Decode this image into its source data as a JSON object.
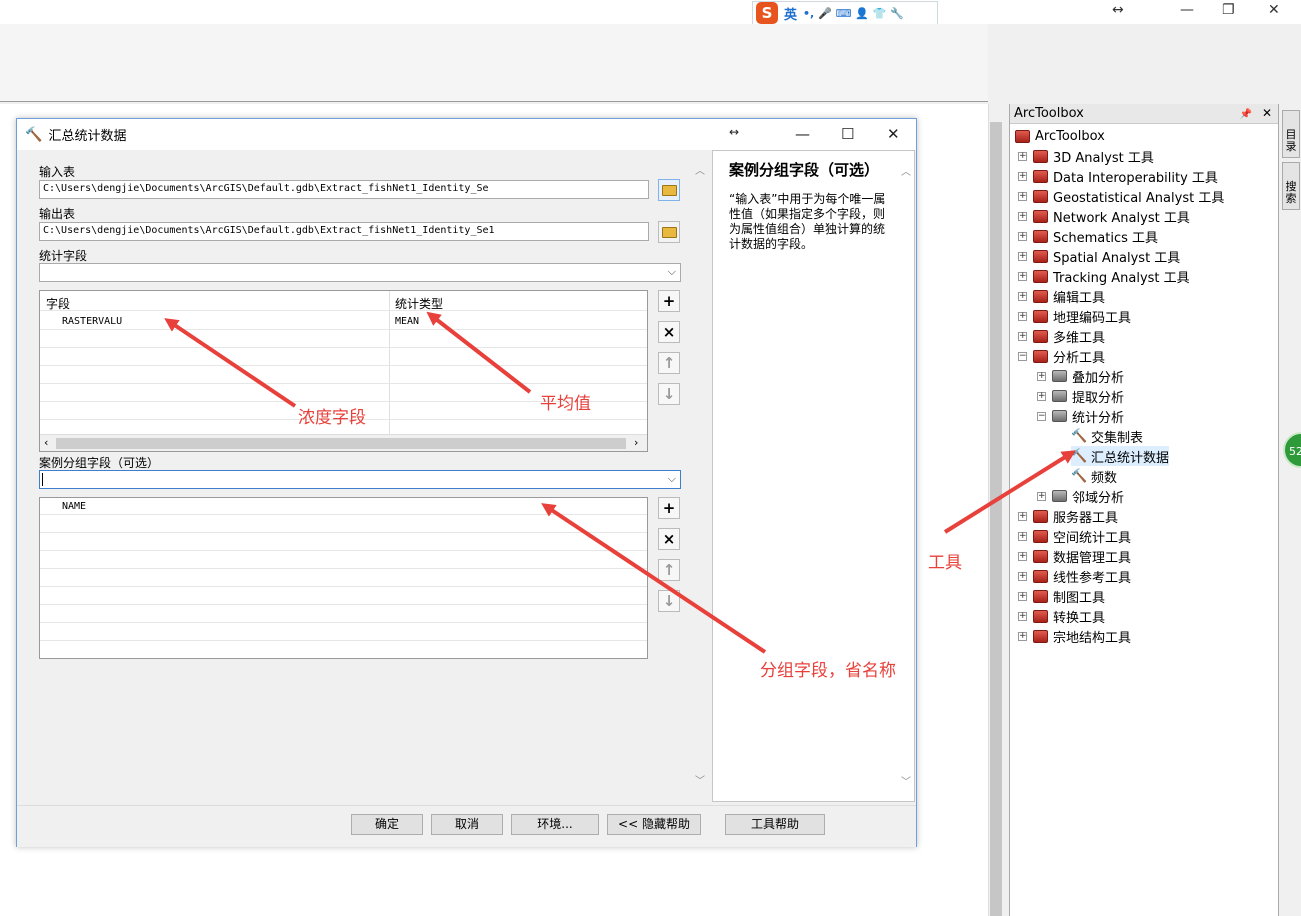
{
  "ime": {
    "logo": "S",
    "mode": "英",
    "glyphs": "•, 🎤 ⌨ 👤 👕 🔧"
  },
  "window_controls": {
    "resize": "↔",
    "minimize": "—",
    "restore": "❐",
    "close": "✕"
  },
  "dialog": {
    "title": "汇总统计数据",
    "input_table": {
      "label": "输入表",
      "value": "C:\\Users\\dengjie\\Documents\\ArcGIS\\Default.gdb\\Extract_fishNet1_Identity_Se"
    },
    "output_table": {
      "label": "输出表",
      "value": "C:\\Users\\dengjie\\Documents\\ArcGIS\\Default.gdb\\Extract_fishNet1_Identity_Se1"
    },
    "stat_fields": {
      "label": "统计字段",
      "columns": [
        "字段",
        "统计类型"
      ],
      "rows": [
        {
          "field": "RASTERVALU",
          "type": "MEAN"
        }
      ]
    },
    "case_field": {
      "label": "案例分组字段（可选）",
      "rows": [
        "NAME"
      ]
    },
    "buttons": {
      "ok": "确定",
      "cancel": "取消",
      "env": "环境...",
      "hide_help": "<< 隐藏帮助",
      "tool_help": "工具帮助"
    },
    "help": {
      "title": "案例分组字段（可选）",
      "text": "“输入表”中用于为每个唯一属性值（如果指定多个字段，则为属性值组合）单独计算的统计数据的字段。"
    }
  },
  "toolbox": {
    "title": "ArcToolbox",
    "pin": "📌",
    "close": "✕",
    "root": "ArcToolbox",
    "items": [
      "3D Analyst 工具",
      "Data Interoperability 工具",
      "Geostatistical Analyst 工具",
      "Network Analyst 工具",
      "Schematics 工具",
      "Spatial Analyst 工具",
      "Tracking Analyst 工具",
      "编辑工具",
      "地理编码工具",
      "多维工具",
      "分析工具"
    ],
    "analysis_children": [
      "叠加分析",
      "提取分析",
      "统计分析"
    ],
    "stat_children": [
      "交集制表",
      "汇总统计数据",
      "频数"
    ],
    "neighbor": "邻域分析",
    "rest": [
      "服务器工具",
      "空间统计工具",
      "数据管理工具",
      "线性参考工具",
      "制图工具",
      "转换工具",
      "宗地结构工具"
    ]
  },
  "side_tabs": [
    "目录",
    "搜索"
  ],
  "badge": "52",
  "annotations": {
    "field": "浓度字段",
    "mean": "平均值",
    "tool": "工具",
    "group": "分组字段，省名称"
  }
}
